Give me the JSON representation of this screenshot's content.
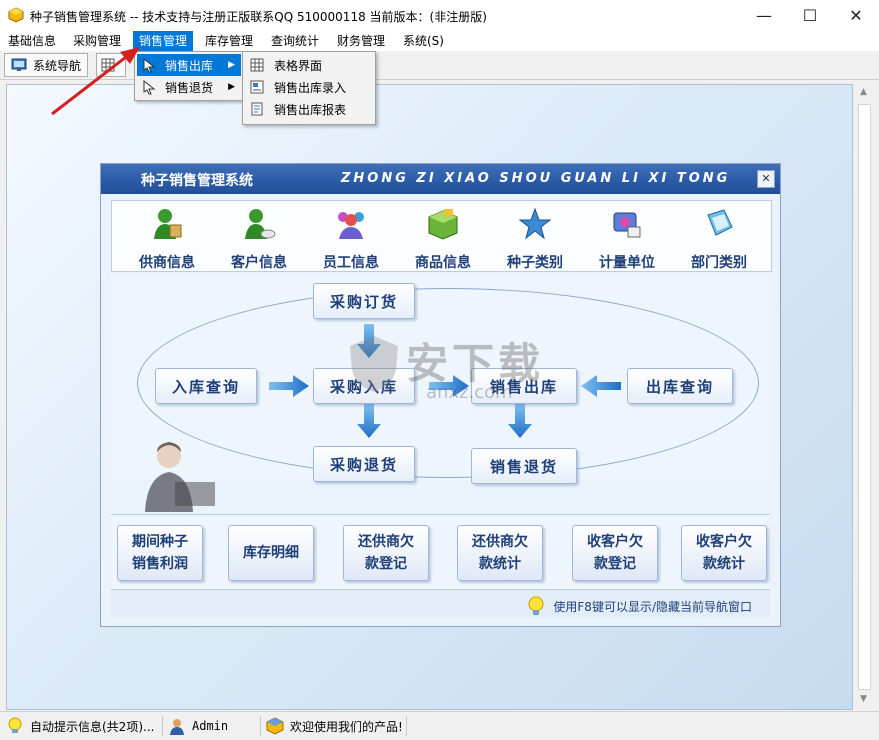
{
  "window": {
    "title": "种子销售管理系统 -- 技术支持与注册正版联系QQ 510000118    当前版本：(非注册版)",
    "minimize": "—",
    "maximize": "☐",
    "close": "✕"
  },
  "menu": {
    "items": [
      {
        "label": "基础信息"
      },
      {
        "label": "采购管理"
      },
      {
        "label": "销售管理"
      },
      {
        "label": "库存管理"
      },
      {
        "label": "查询统计"
      },
      {
        "label": "财务管理"
      },
      {
        "label": "系统(S)"
      }
    ]
  },
  "toolbar": {
    "nav_label": "系统导航"
  },
  "sales_menu": {
    "items": [
      {
        "label": "销售出库",
        "has_submenu": true
      },
      {
        "label": "销售退货",
        "has_submenu": true
      }
    ]
  },
  "sales_out_submenu": {
    "items": [
      {
        "label": "表格界面"
      },
      {
        "label": "销售出库录入"
      },
      {
        "label": "销售出库报表"
      }
    ]
  },
  "nav": {
    "title_cn": "种子销售管理系统",
    "title_en": "ZHONG ZI XIAO SHOU GUAN LI XI TONG",
    "close": "✕",
    "icon_row": [
      {
        "label": "供商信息",
        "icon": "supplier-icon"
      },
      {
        "label": "客户信息",
        "icon": "customer-icon"
      },
      {
        "label": "员工信息",
        "icon": "employee-icon"
      },
      {
        "label": "商品信息",
        "icon": "product-icon"
      },
      {
        "label": "种子类别",
        "icon": "category-icon"
      },
      {
        "label": "计量单位",
        "icon": "unit-icon"
      },
      {
        "label": "部门类别",
        "icon": "department-icon"
      }
    ],
    "flow": {
      "purchase_order": "采购订货",
      "stock_in_query": "入库查询",
      "purchase_in": "采购入库",
      "sales_out": "销售出库",
      "stock_out_query": "出库查询",
      "purchase_return": "采购退货",
      "sales_return": "销售退货"
    },
    "bottom_buttons": [
      {
        "label": "期间种子\n销售利润"
      },
      {
        "label": "库存明细"
      },
      {
        "label": "还供商欠\n款登记"
      },
      {
        "label": "还供商欠\n款统计"
      },
      {
        "label": "收客户欠\n款登记"
      },
      {
        "label": "收客户欠\n款统计"
      }
    ],
    "hint": "使用F8键可以显示/隐藏当前导航窗口"
  },
  "watermark": {
    "text": "安下载",
    "sub": "anxz.com"
  },
  "status": {
    "info": "自动提示信息(共2项)...",
    "user": "Admin",
    "welcome": "欢迎使用我们的产品!"
  },
  "colors": {
    "accent": "#0078d7",
    "title_blue": "#2a5aa6",
    "label_blue": "#1f3f78",
    "arrow_red": "#d42020"
  }
}
